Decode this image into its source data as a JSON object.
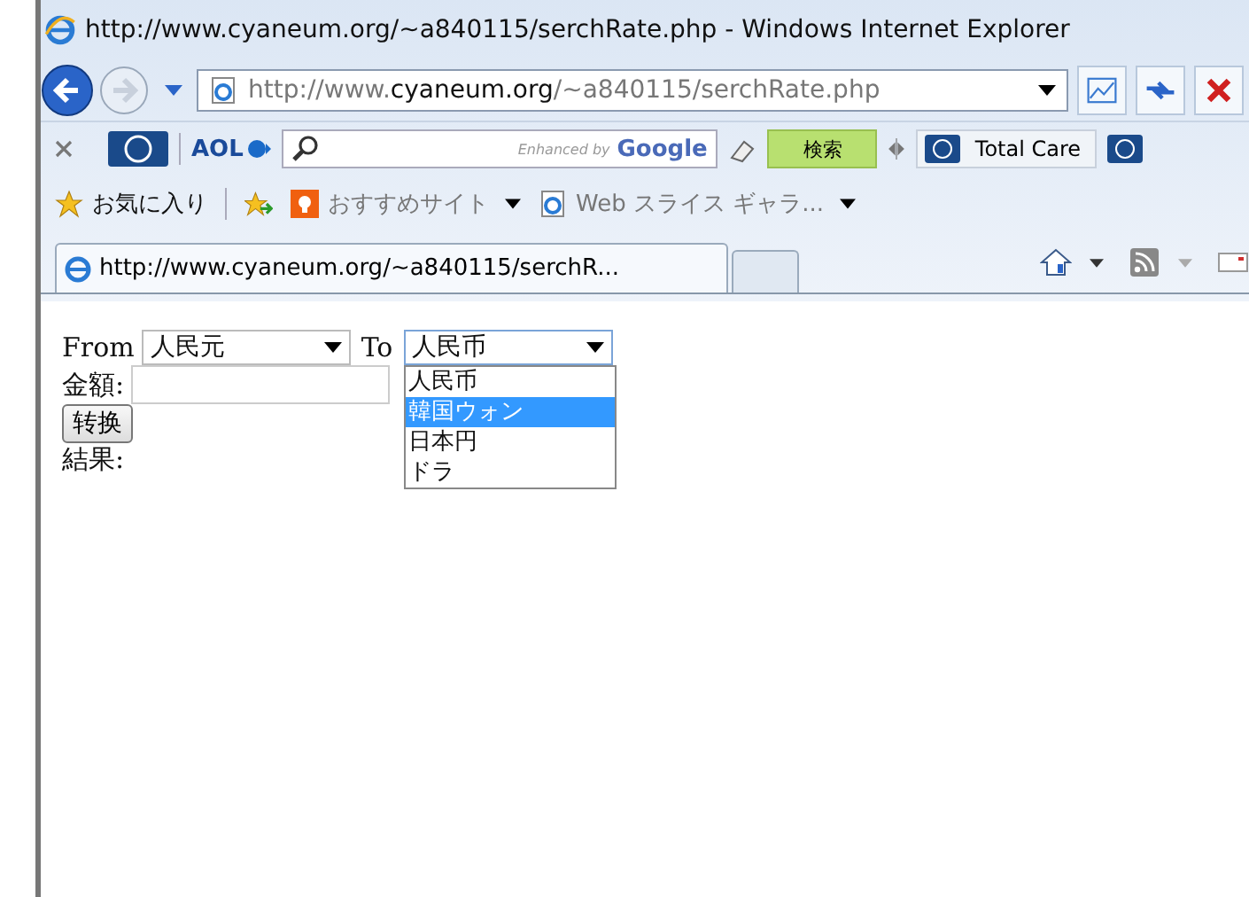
{
  "window": {
    "title": "http://www.cyaneum.org/~a840115/serchRate.php - Windows Internet Explorer"
  },
  "address_bar": {
    "url_prefix": "http://www.",
    "url_domain": "cyaneum.org",
    "url_suffix": "/~a840115/serchRate.php"
  },
  "toolbar": {
    "aol": "AOL",
    "search_brand": "Enhanced by",
    "search_engine": "Google",
    "search_button": "検索",
    "total_care": "Total Care"
  },
  "favorites_bar": {
    "favorites": "お気に入り",
    "items": [
      "おすすめサイト",
      "Web スライス ギャラ..."
    ]
  },
  "tabs": [
    {
      "label": "http://www.cyaneum.org/~a840115/serchR...",
      "selected": true
    }
  ],
  "form": {
    "from_label": "From",
    "from_value": "人民元",
    "to_label": "To",
    "to_value": "人民币",
    "options": [
      {
        "label": "人民币",
        "selected": false
      },
      {
        "label": "韓国ウォン",
        "selected": true
      },
      {
        "label": "日本円",
        "selected": false
      },
      {
        "label": "ドラ",
        "selected": false
      }
    ],
    "amount_label": "金額:",
    "convert_button": "转换",
    "result_label": "結果:"
  }
}
